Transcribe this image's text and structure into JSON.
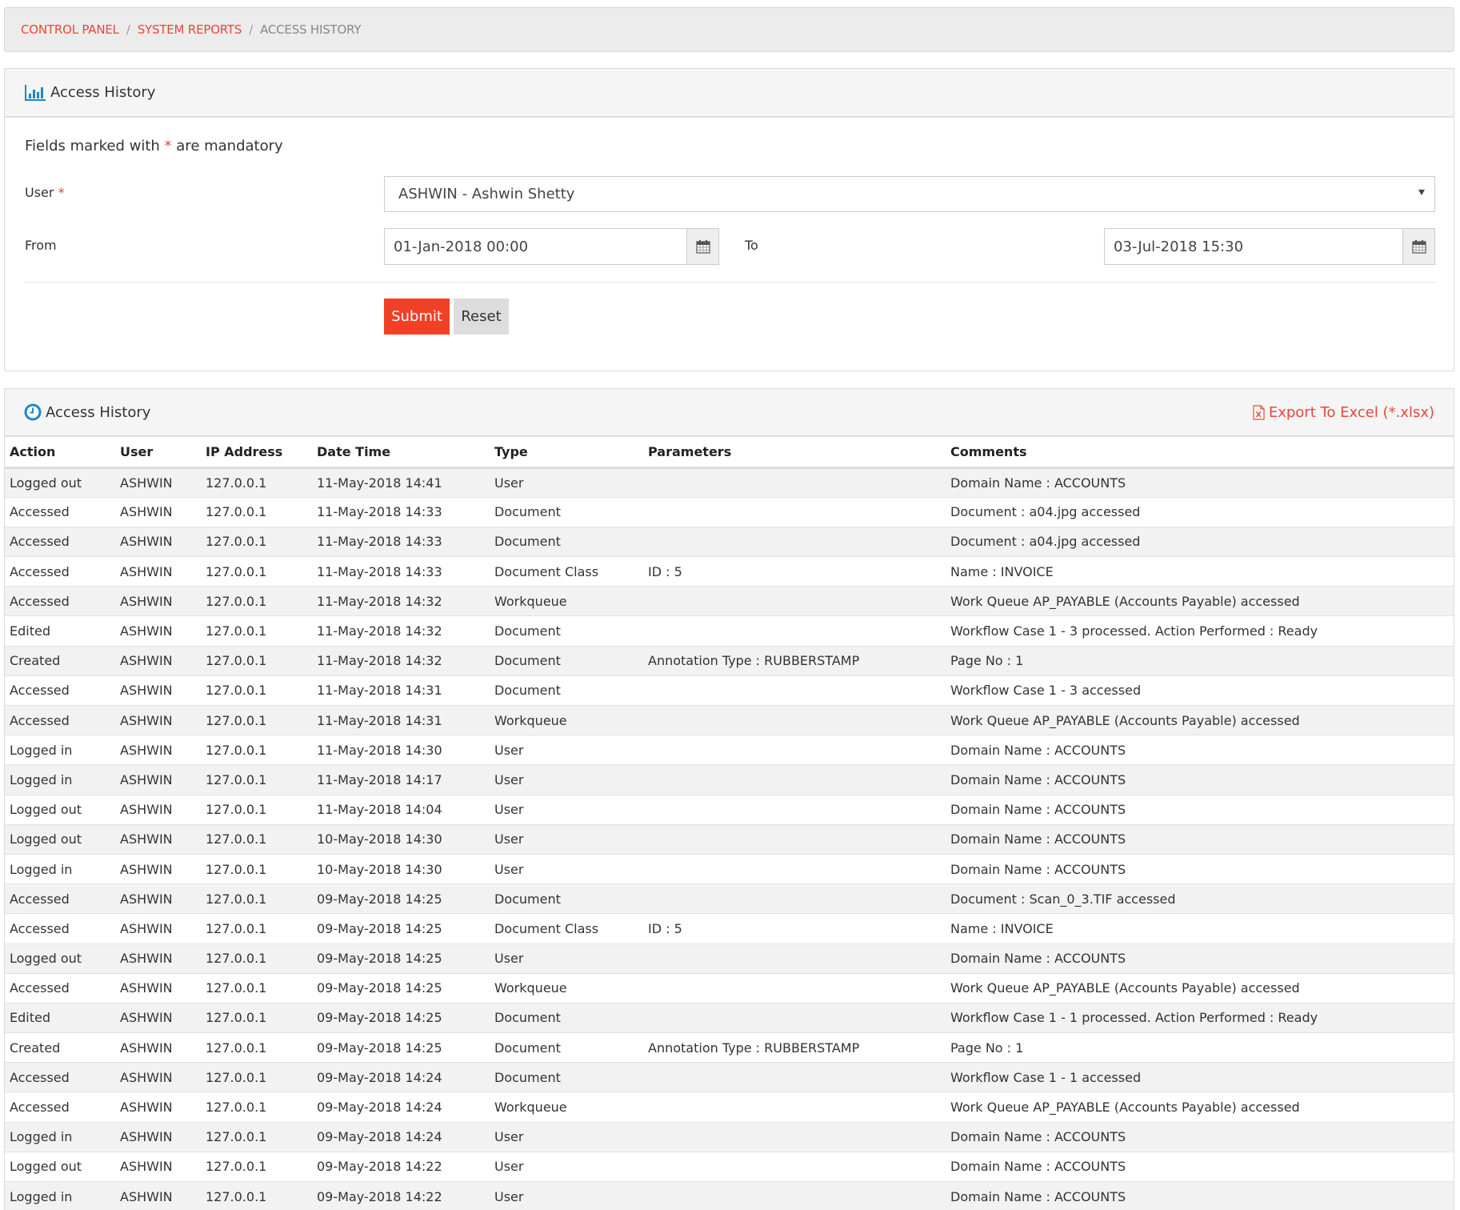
{
  "breadcrumb": {
    "items": [
      {
        "label": "CONTROL PANEL"
      },
      {
        "label": "SYSTEM REPORTS"
      },
      {
        "label": "ACCESS HISTORY"
      }
    ],
    "separator": "/"
  },
  "filter_panel": {
    "title": "Access History",
    "icon": "bar-chart-icon",
    "mandatory_note_prefix": "Fields marked with",
    "mandatory_marker": "*",
    "mandatory_note_suffix": "are mandatory",
    "user_label": "User",
    "user_value": "ASHWIN - Ashwin Shetty",
    "from_label": "From",
    "from_value": "01-Jan-2018 00:00",
    "to_label": "To",
    "to_value": "03-Jul-2018 15:30",
    "submit_label": "Submit",
    "reset_label": "Reset"
  },
  "results_panel": {
    "title": "Access History",
    "icon": "clock-icon",
    "export_label": "Export To Excel (*.xlsx)",
    "export_icon": "excel-file-icon",
    "columns": [
      "Action",
      "User",
      "IP Address",
      "Date Time",
      "Type",
      "Parameters",
      "Comments"
    ],
    "rows": [
      [
        "Logged out",
        "ASHWIN",
        "127.0.0.1",
        "11-May-2018 14:41",
        "User",
        "",
        "Domain Name : ACCOUNTS"
      ],
      [
        "Accessed",
        "ASHWIN",
        "127.0.0.1",
        "11-May-2018 14:33",
        "Document",
        "",
        "Document : a04.jpg accessed"
      ],
      [
        "Accessed",
        "ASHWIN",
        "127.0.0.1",
        "11-May-2018 14:33",
        "Document",
        "",
        "Document : a04.jpg accessed"
      ],
      [
        "Accessed",
        "ASHWIN",
        "127.0.0.1",
        "11-May-2018 14:33",
        "Document Class",
        "ID : 5",
        "Name : INVOICE"
      ],
      [
        "Accessed",
        "ASHWIN",
        "127.0.0.1",
        "11-May-2018 14:32",
        "Workqueue",
        "",
        "Work Queue AP_PAYABLE (Accounts Payable) accessed"
      ],
      [
        "Edited",
        "ASHWIN",
        "127.0.0.1",
        "11-May-2018 14:32",
        "Document",
        "",
        "Workflow Case 1 - 3 processed. Action Performed : Ready"
      ],
      [
        "Created",
        "ASHWIN",
        "127.0.0.1",
        "11-May-2018 14:32",
        "Document",
        "Annotation Type : RUBBERSTAMP",
        "Page No : 1"
      ],
      [
        "Accessed",
        "ASHWIN",
        "127.0.0.1",
        "11-May-2018 14:31",
        "Document",
        "",
        "Workflow Case 1 - 3 accessed"
      ],
      [
        "Accessed",
        "ASHWIN",
        "127.0.0.1",
        "11-May-2018 14:31",
        "Workqueue",
        "",
        "Work Queue AP_PAYABLE (Accounts Payable) accessed"
      ],
      [
        "Logged in",
        "ASHWIN",
        "127.0.0.1",
        "11-May-2018 14:30",
        "User",
        "",
        "Domain Name : ACCOUNTS"
      ],
      [
        "Logged in",
        "ASHWIN",
        "127.0.0.1",
        "11-May-2018 14:17",
        "User",
        "",
        "Domain Name : ACCOUNTS"
      ],
      [
        "Logged out",
        "ASHWIN",
        "127.0.0.1",
        "11-May-2018 14:04",
        "User",
        "",
        "Domain Name : ACCOUNTS"
      ],
      [
        "Logged out",
        "ASHWIN",
        "127.0.0.1",
        "10-May-2018 14:30",
        "User",
        "",
        "Domain Name : ACCOUNTS"
      ],
      [
        "Logged in",
        "ASHWIN",
        "127.0.0.1",
        "10-May-2018 14:30",
        "User",
        "",
        "Domain Name : ACCOUNTS"
      ],
      [
        "Accessed",
        "ASHWIN",
        "127.0.0.1",
        "09-May-2018 14:25",
        "Document",
        "",
        "Document : Scan_0_3.TIF accessed"
      ],
      [
        "Accessed",
        "ASHWIN",
        "127.0.0.1",
        "09-May-2018 14:25",
        "Document Class",
        "ID : 5",
        "Name : INVOICE"
      ],
      [
        "Logged out",
        "ASHWIN",
        "127.0.0.1",
        "09-May-2018 14:25",
        "User",
        "",
        "Domain Name : ACCOUNTS"
      ],
      [
        "Accessed",
        "ASHWIN",
        "127.0.0.1",
        "09-May-2018 14:25",
        "Workqueue",
        "",
        "Work Queue AP_PAYABLE (Accounts Payable) accessed"
      ],
      [
        "Edited",
        "ASHWIN",
        "127.0.0.1",
        "09-May-2018 14:25",
        "Document",
        "",
        "Workflow Case 1 - 1 processed. Action Performed : Ready"
      ],
      [
        "Created",
        "ASHWIN",
        "127.0.0.1",
        "09-May-2018 14:25",
        "Document",
        "Annotation Type : RUBBERSTAMP",
        "Page No : 1"
      ],
      [
        "Accessed",
        "ASHWIN",
        "127.0.0.1",
        "09-May-2018 14:24",
        "Document",
        "",
        "Workflow Case 1 - 1 accessed"
      ],
      [
        "Accessed",
        "ASHWIN",
        "127.0.0.1",
        "09-May-2018 14:24",
        "Workqueue",
        "",
        "Work Queue AP_PAYABLE (Accounts Payable) accessed"
      ],
      [
        "Logged in",
        "ASHWIN",
        "127.0.0.1",
        "09-May-2018 14:24",
        "User",
        "",
        "Domain Name : ACCOUNTS"
      ],
      [
        "Logged out",
        "ASHWIN",
        "127.0.0.1",
        "09-May-2018 14:22",
        "User",
        "",
        "Domain Name : ACCOUNTS"
      ],
      [
        "Logged in",
        "ASHWIN",
        "127.0.0.1",
        "09-May-2018 14:22",
        "User",
        "",
        "Domain Name : ACCOUNTS"
      ]
    ]
  },
  "colors": {
    "accent": "#e9473a",
    "submit": "#f04127",
    "icon_blue": "#1a8ac6"
  }
}
